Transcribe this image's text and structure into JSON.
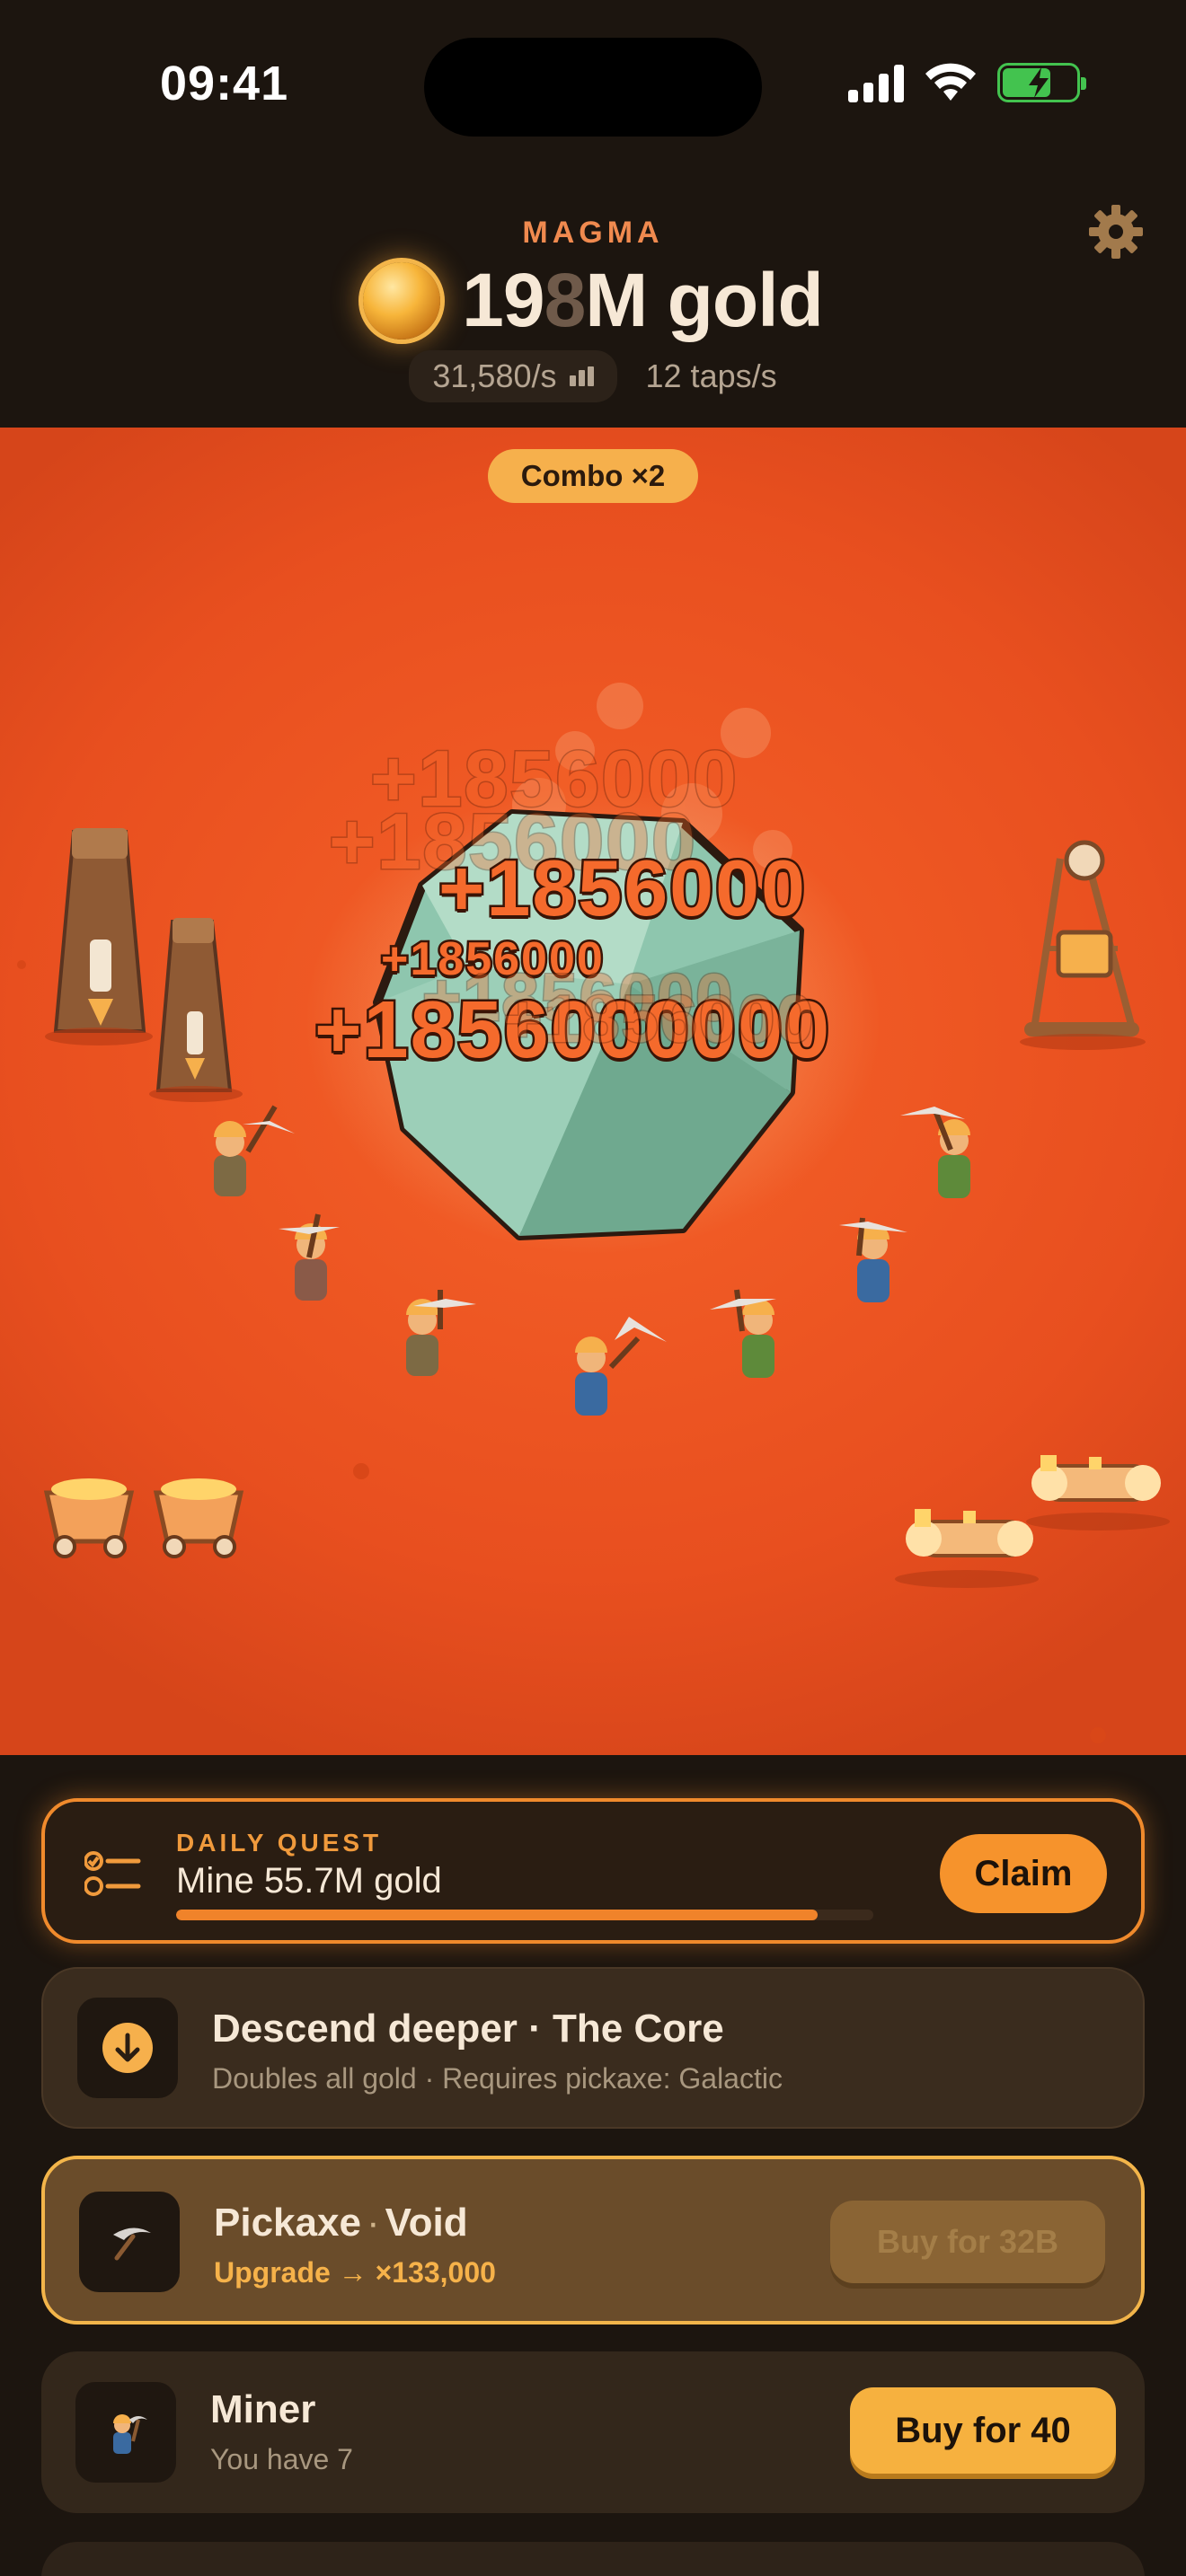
{
  "status_bar": {
    "time": "09:41"
  },
  "header": {
    "layer_name": "MAGMA",
    "gold_prefix": "19",
    "gold_ghost_digit": "8",
    "gold_suffix": "M gold",
    "rate": "31,580/s",
    "taps": "12 taps/s"
  },
  "scene": {
    "combo": "Combo ×2",
    "floating_gains": [
      "+1856000",
      "+1856000",
      "+1856000",
      "+1856000",
      "+1856000",
      "+1856000000",
      "+1856000"
    ]
  },
  "daily_quest": {
    "label": "DAILY QUEST",
    "title": "Mine 55.7M gold",
    "progress": 0.92,
    "claim_label": "Claim"
  },
  "descend": {
    "title": "Descend deeper · The Core",
    "subtitle": "Doubles all gold · Requires pickaxe: Galactic"
  },
  "pickaxe": {
    "title_a": "Pickaxe",
    "dot": "·",
    "title_b": "Void",
    "subtitle": "Upgrade → ×133,000",
    "buy_label": "Buy for 32B"
  },
  "miner": {
    "title": "Miner",
    "subtitle": "You have 7",
    "buy_label": "Buy for 40"
  },
  "colors": {
    "accent": "#f6932c",
    "scene_lava": "#ee5723",
    "panel_bg": "#1c150f",
    "gold": "#f6b13f"
  },
  "icons": [
    "settings-gear-icon",
    "gold-coin-icon",
    "bars-icon",
    "quest-list-icon",
    "arrow-down-circle-icon",
    "pickaxe-icon",
    "miner-icon"
  ]
}
